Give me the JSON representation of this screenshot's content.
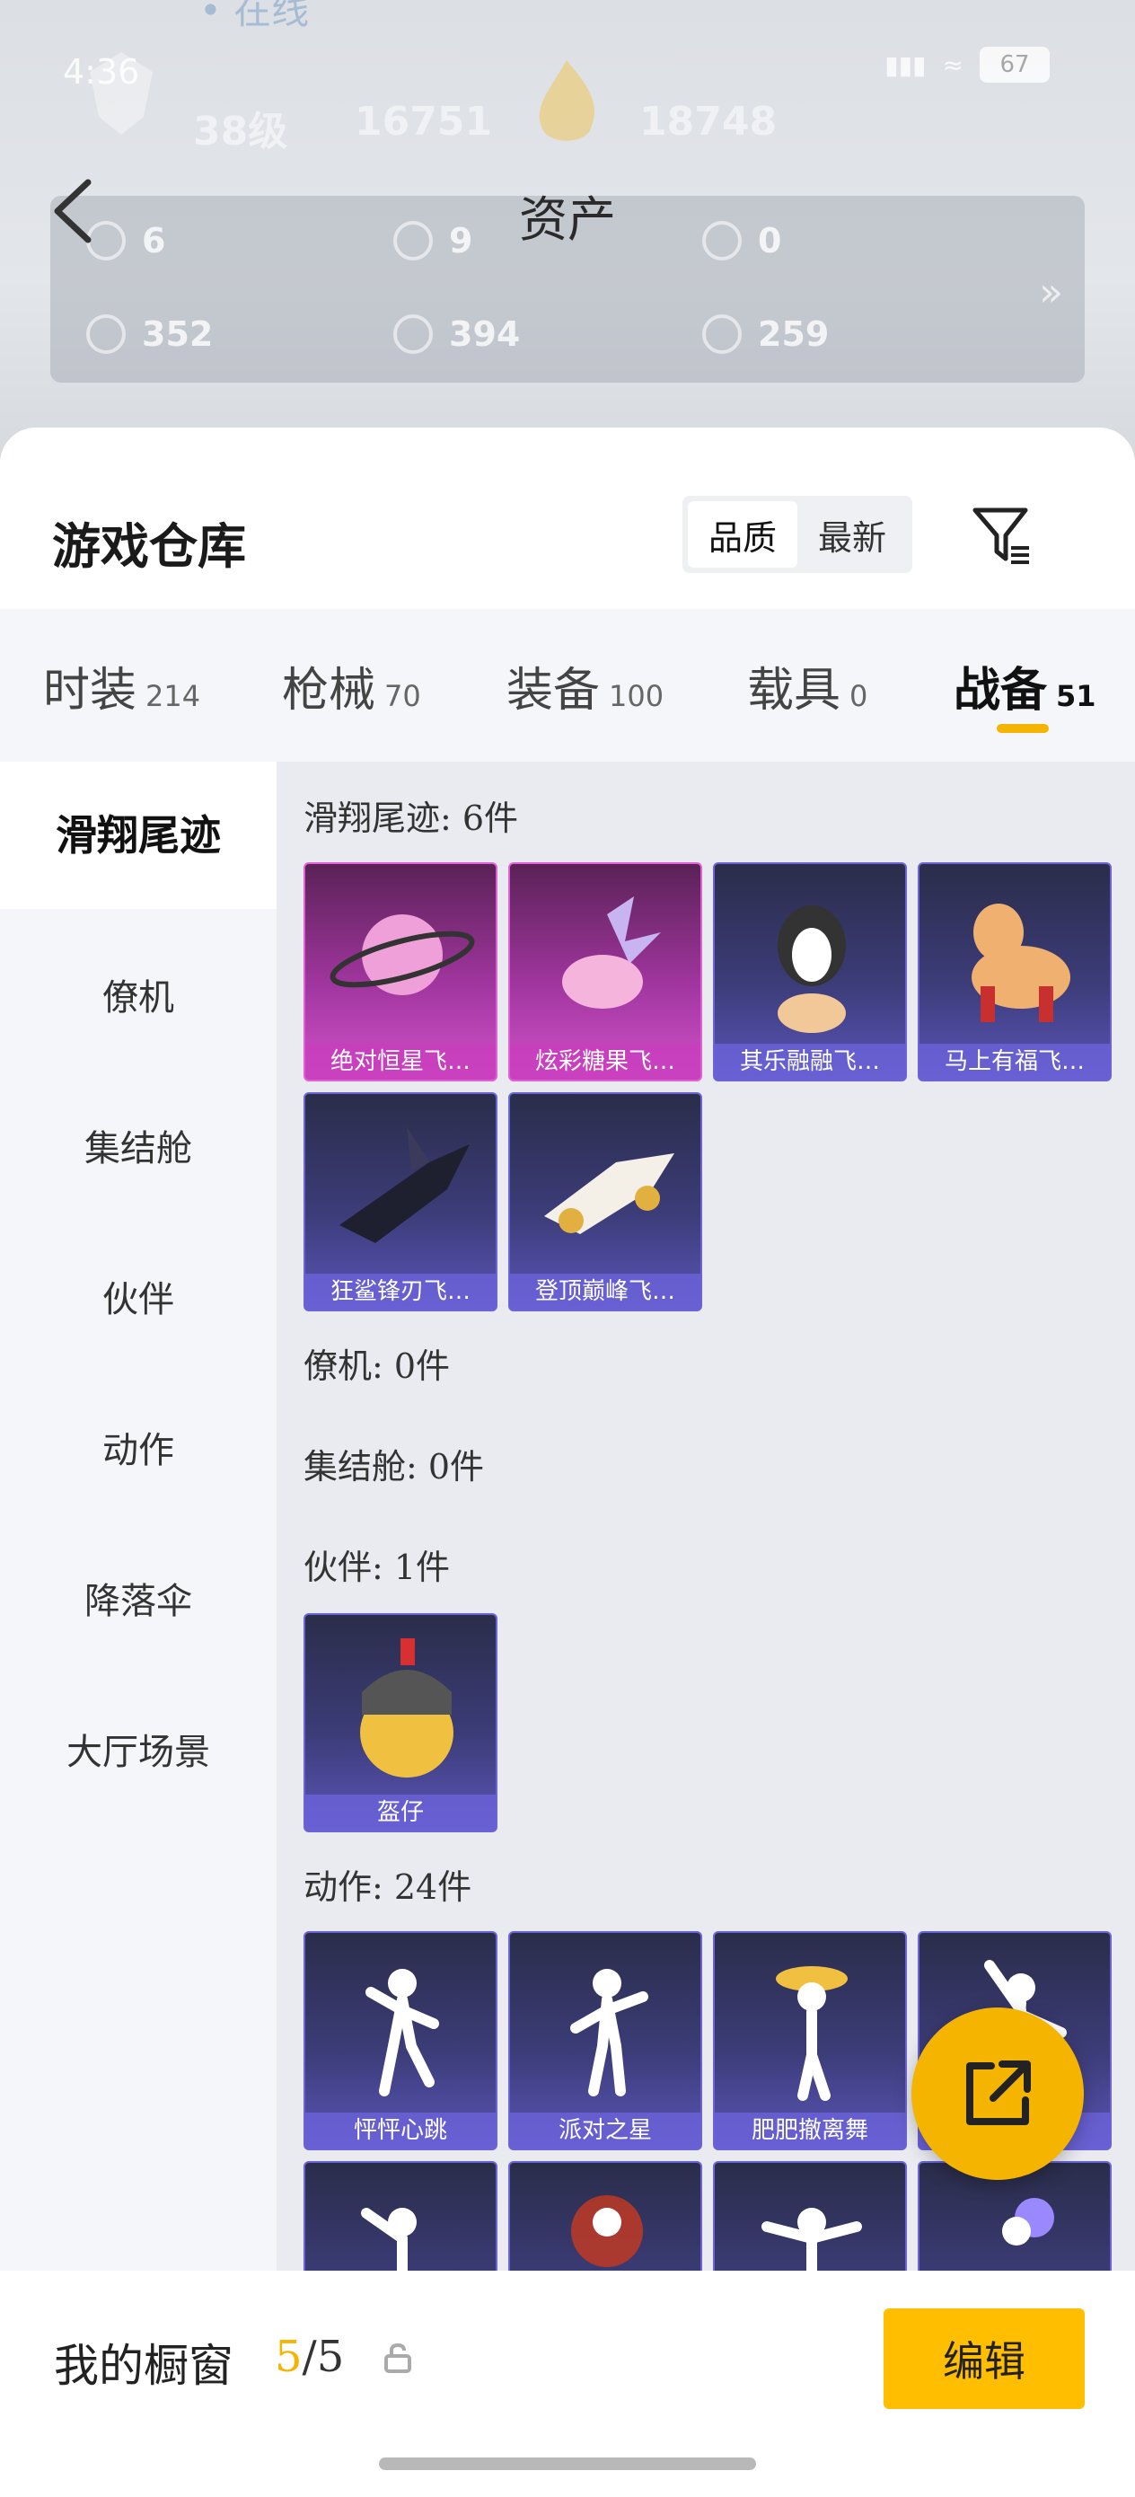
{
  "status_bar": {
    "time": "4:36",
    "battery": "67"
  },
  "top_partial_text": "• 在线",
  "profile_ghost": {
    "level": "38级",
    "points": "16751",
    "score": "18748"
  },
  "page_title": "资产",
  "assets": [
    "6",
    "9",
    "0",
    "352",
    "394",
    "259"
  ],
  "warehouse": {
    "title": "游戏仓库",
    "sort": [
      "品质",
      "最新"
    ]
  },
  "tabs": [
    {
      "label": "时装",
      "count": "214"
    },
    {
      "label": "枪械",
      "count": "70"
    },
    {
      "label": "装备",
      "count": "100"
    },
    {
      "label": "载具",
      "count": "0"
    },
    {
      "label": "战备",
      "count": "51"
    }
  ],
  "sidebar": [
    "滑翔尾迹",
    "僚机",
    "集结舱",
    "伙伴",
    "动作",
    "降落伞",
    "大厅场景"
  ],
  "sections": {
    "glide": "滑翔尾迹: 6件",
    "drone": "僚机: 0件",
    "pod": "集结舱: 0件",
    "partner": "伙伴: 1件",
    "action": "动作: 24件"
  },
  "glide_items": [
    "绝对恒星飞…",
    "炫彩糖果飞…",
    "其乐融融飞…",
    "马上有福飞…",
    "狂鲨锋刃飞…",
    "登顶巅峰飞…"
  ],
  "partner_items": [
    "盔仔"
  ],
  "action_items": [
    "怦怦心跳",
    "派对之星",
    "肥肥撤离舞",
    "",
    "",
    "",
    "",
    ""
  ],
  "showcase": {
    "label": "我的橱窗",
    "current": "5",
    "total": "/5",
    "edit": "编辑"
  },
  "colors": {
    "accent": "#f5b400",
    "card_blue": "#3c3c78",
    "card_pink": "#a0359e"
  }
}
